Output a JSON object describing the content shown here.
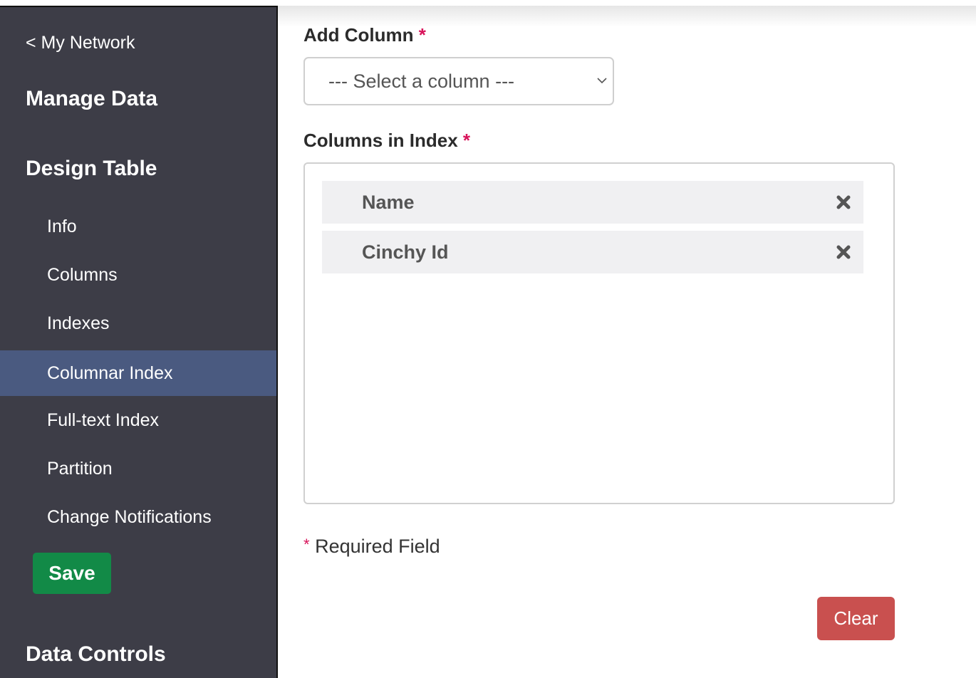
{
  "sidebar": {
    "back_link": "< My Network",
    "sections": [
      {
        "title": "Manage Data"
      },
      {
        "title": "Design Table"
      },
      {
        "title": "Data Controls"
      }
    ],
    "items": [
      {
        "label": "Info",
        "active": false
      },
      {
        "label": "Columns",
        "active": false
      },
      {
        "label": "Indexes",
        "active": false
      },
      {
        "label": "Columnar Index",
        "active": true
      },
      {
        "label": "Full-text Index",
        "active": false
      },
      {
        "label": "Partition",
        "active": false
      },
      {
        "label": "Change Notifications",
        "active": false
      }
    ],
    "save_label": "Save"
  },
  "main": {
    "add_column": {
      "label": "Add Column",
      "required_marker": "*",
      "selected_value": "--- Select a column ---"
    },
    "columns_in_index": {
      "label": "Columns in Index",
      "required_marker": "*",
      "items": [
        {
          "name": "Name",
          "remove_icon": "close-icon"
        },
        {
          "name": "Cinchy Id",
          "remove_icon": "close-icon"
        }
      ]
    },
    "required_note": {
      "marker": "*",
      "text": "Required Field"
    },
    "clear_label": "Clear"
  },
  "colors": {
    "sidebar_bg": "#3d3d47",
    "active_item_bg": "#4a5a80",
    "save_button": "#128a47",
    "clear_button": "#c9504f",
    "required_marker": "#d8135a"
  }
}
